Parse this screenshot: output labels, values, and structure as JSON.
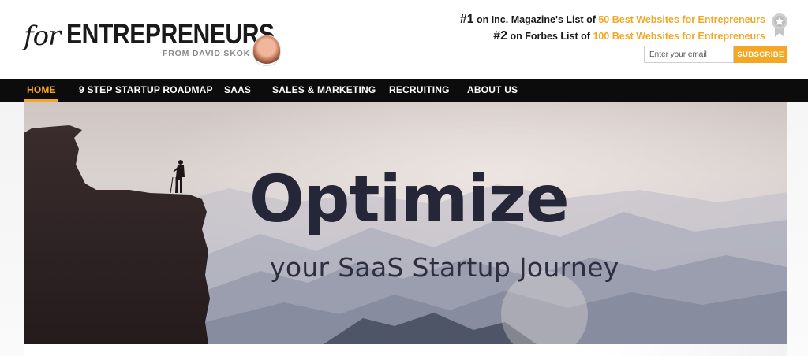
{
  "logo": {
    "for_text": "for",
    "main_text": "ENTREPRENEURS",
    "sub_text": "FROM DAVID SKOK"
  },
  "rankings": [
    {
      "num": "#1",
      "pre": " on Inc. Magazine's List of ",
      "highlight": "50 Best Websites for Entrepreneurs"
    },
    {
      "num": "#2",
      "pre": " on Forbes List of ",
      "highlight": "100 Best Websites for Entrepreneurs"
    }
  ],
  "subscribe": {
    "placeholder": "Enter your email",
    "button_label": "SUBSCRIBE"
  },
  "nav": {
    "items": [
      {
        "label": "HOME",
        "active": true
      },
      {
        "label": "9 STEP STARTUP ROADMAP",
        "active": false
      },
      {
        "label": "SAAS",
        "active": false
      },
      {
        "label": "SALES & MARKETING",
        "active": false
      },
      {
        "label": "RECRUITING",
        "active": false
      },
      {
        "label": "ABOUT US",
        "active": false
      }
    ]
  },
  "hero": {
    "title": "Optimize",
    "subtitle": "your SaaS Startup Journey"
  },
  "colors": {
    "accent": "#f5a623",
    "nav_bg": "#0c0c0c",
    "hero_text": "#252638"
  },
  "icons": {
    "badge": "award-ribbon-icon",
    "avatar": "author-avatar"
  }
}
